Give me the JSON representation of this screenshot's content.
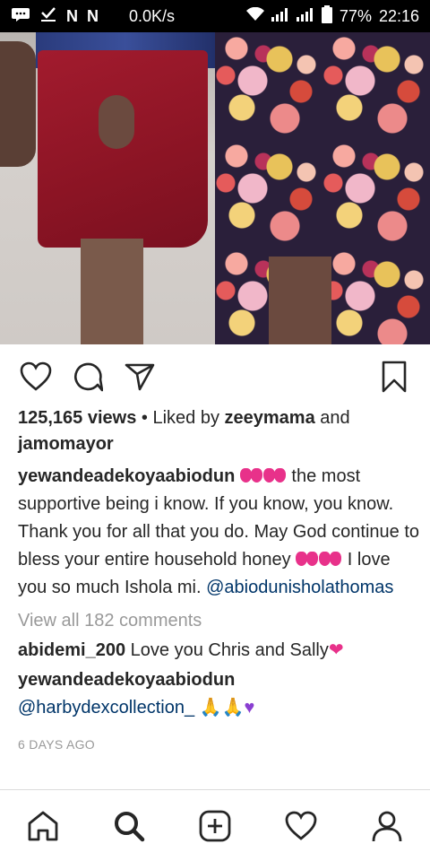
{
  "status_bar": {
    "speed": "0.0K/s",
    "battery": "77%",
    "time": "22:16",
    "icons": [
      "notification-icon",
      "download-done-icon",
      "n-icon",
      "n-icon",
      "wifi-icon",
      "signal-icon",
      "signal-icon",
      "battery-icon"
    ]
  },
  "post": {
    "actions": [
      "heart-icon",
      "comment-icon",
      "share-icon",
      "bookmark-icon"
    ],
    "views": "125,165 views",
    "liked_by_prefix": "• Liked by",
    "liked_by_user": "zeeymama",
    "liked_by_and": "and",
    "liked_by_other": "jamomayor",
    "caption": {
      "username": "yewandeadekoyaabiodun",
      "text_part1": "the most supportive being i know.  If you know, you know. Thank you for all that you do. May God continue to bless your entire household honey",
      "text_part2": "I love you so much Ishola mi.",
      "mention": "@abiodunisholathomas"
    },
    "view_all_comments": "View all 182 comments",
    "comments": [
      {
        "username": "abidemi_200",
        "text": "Love you Chris and Sally"
      },
      {
        "username": "yewandeadekoyaabiodun",
        "mention": "@harbydexcollection_"
      }
    ],
    "timestamp": "6 DAYS AGO"
  },
  "bottom_nav": [
    "home-icon",
    "search-icon",
    "add-post-icon",
    "activity-icon",
    "profile-icon"
  ]
}
